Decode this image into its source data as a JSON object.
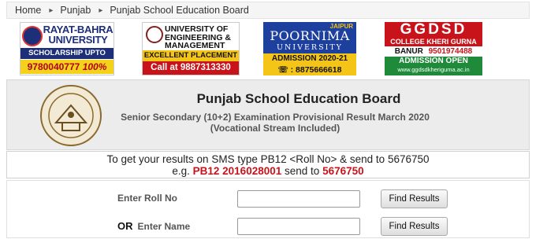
{
  "breadcrumb": {
    "items": [
      "Home",
      "Punjab",
      "Punjab School Education Board"
    ]
  },
  "ads": [
    {
      "name": "RAYAT-BAHRA UNIVERSITY",
      "strip": "SCHOLARSHIP UPTO",
      "phone": "9780040777",
      "offer": "100%"
    },
    {
      "name": "UNIVERSITY OF ENGINEERING & MANAGEMENT",
      "strip": "EXCELLENT PLACEMENT",
      "phone": "Call at 9887313330"
    },
    {
      "city": "JAIPUR",
      "name": "POORNIMA",
      "sub": "UNIVERSITY",
      "strip": "ADMISSION 2020-21",
      "phone": "☏ : 8875666618"
    },
    {
      "name": "GGDSD",
      "sub": "COLLEGE KHERI GURNA",
      "phone_prefix": "BANUR",
      "phone": "9501974488",
      "strip": "ADMISSION OPEN",
      "url": "www.ggdsdkheriguma.ac.in"
    }
  ],
  "board": {
    "title": "Punjab School Education Board",
    "subtitle": "Senior Secondary (10+2) Examination Provisional Result March 2020",
    "stream": "(Vocational Stream Included)"
  },
  "sms": {
    "line1": "To get your results on SMS type PB12 <Roll No> & send to 5676750",
    "eg_prefix": "e.g.",
    "eg_code": "PB12  2016028001",
    "eg_send": "send to",
    "eg_number": "5676750"
  },
  "form": {
    "roll_label": "Enter Roll No",
    "roll_value": "",
    "or_label": "OR",
    "name_label": "Enter Name",
    "name_value": "",
    "find_button": "Find Results",
    "find_button2": "Find Results"
  },
  "colors": {
    "accent_red": "#c8131b",
    "panel_gray": "#ececec"
  }
}
